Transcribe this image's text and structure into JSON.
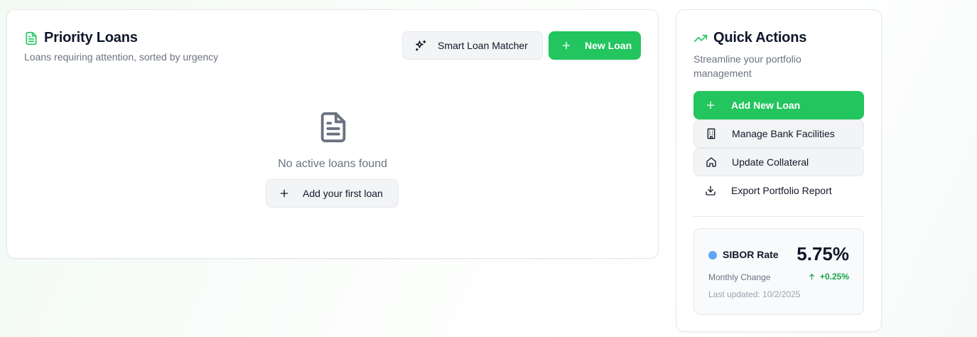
{
  "priority_loans": {
    "title": "Priority Loans",
    "subtitle": "Loans requiring attention, sorted by urgency",
    "smart_matcher_label": "Smart Loan Matcher",
    "new_loan_label": "New Loan",
    "empty_state": {
      "message": "No active loans found",
      "add_first_label": "Add your first loan"
    }
  },
  "quick_actions": {
    "title": "Quick Actions",
    "subtitle": "Streamline your portfolio management",
    "actions": [
      {
        "label": "Add New Loan",
        "icon": "plus-icon"
      },
      {
        "label": "Manage Bank Facilities",
        "icon": "building-icon"
      },
      {
        "label": "Update Collateral",
        "icon": "home-icon"
      },
      {
        "label": "Export Portfolio Report",
        "icon": "download-icon"
      }
    ],
    "rate": {
      "name": "SIBOR Rate",
      "value": "5.75%",
      "change_label": "Monthly Change",
      "change_value": "+0.25%",
      "last_updated": "Last updated: 10/2/2025"
    }
  },
  "colors": {
    "accent_green": "#22c55e",
    "positive_green": "#16a34a",
    "rate_dot_blue": "#60a5fa"
  }
}
